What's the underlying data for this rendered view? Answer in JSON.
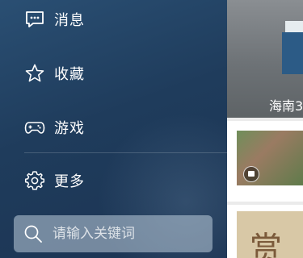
{
  "drawer": {
    "menu": [
      {
        "id": "messages",
        "label": "消息",
        "icon": "message-icon"
      },
      {
        "id": "favorites",
        "label": "收藏",
        "icon": "star-icon"
      },
      {
        "id": "games",
        "label": "游戏",
        "icon": "gamepad-icon"
      },
      {
        "id": "more",
        "label": "更多",
        "icon": "gear-icon"
      }
    ],
    "search": {
      "placeholder": "请输入关键词",
      "value": "",
      "icon": "search-icon"
    }
  },
  "content": {
    "hero_caption": "海南3",
    "cards": [
      {
        "thumb": "group-photo",
        "badge_icon": "video-icon"
      },
      {
        "thumb": "poster",
        "thumb_text": "赏"
      }
    ]
  },
  "colors": {
    "drawer_bg": "#1f3c5c",
    "text": "#ffffff"
  }
}
